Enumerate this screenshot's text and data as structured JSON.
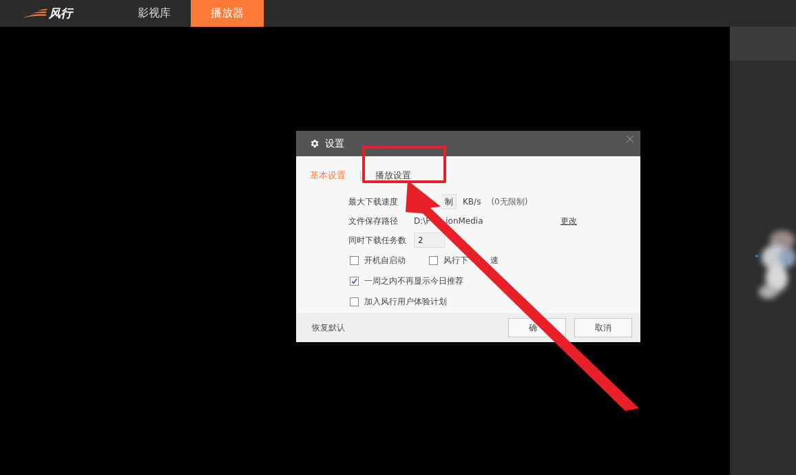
{
  "app": {
    "logo": "风行",
    "tabs": [
      {
        "label": "影视库",
        "selected": false
      },
      {
        "label": "播放器",
        "selected": true
      }
    ]
  },
  "dialog": {
    "title": "设置",
    "tabs": [
      {
        "label": "基本设置",
        "selected": true
      },
      {
        "label": "播放设置",
        "selected": false
      }
    ],
    "speed": {
      "label": "最大下载速度",
      "value": "制",
      "unit": "KB/s",
      "hint": "(0无限制)"
    },
    "path": {
      "label": "文件保存路径",
      "value_parts": [
        "D:\\F",
        "ionMedia"
      ],
      "link": "更改"
    },
    "tasks": {
      "label": "同时下载任务数",
      "value": "2"
    },
    "checkbox_rows": [
      [
        {
          "label_parts": [
            "开机自启动"
          ],
          "checked": false
        },
        {
          "label_parts": [
            "风行下",
            "速"
          ],
          "checked": false
        }
      ],
      [
        {
          "label_parts": [
            "一周之内不再显示今日推荐"
          ],
          "checked": true
        }
      ],
      [
        {
          "label_parts": [
            "加入风行用户体验计划"
          ],
          "checked": false
        }
      ]
    ],
    "reset": "恢复默认",
    "buttons": [
      "确",
      "取消"
    ]
  }
}
